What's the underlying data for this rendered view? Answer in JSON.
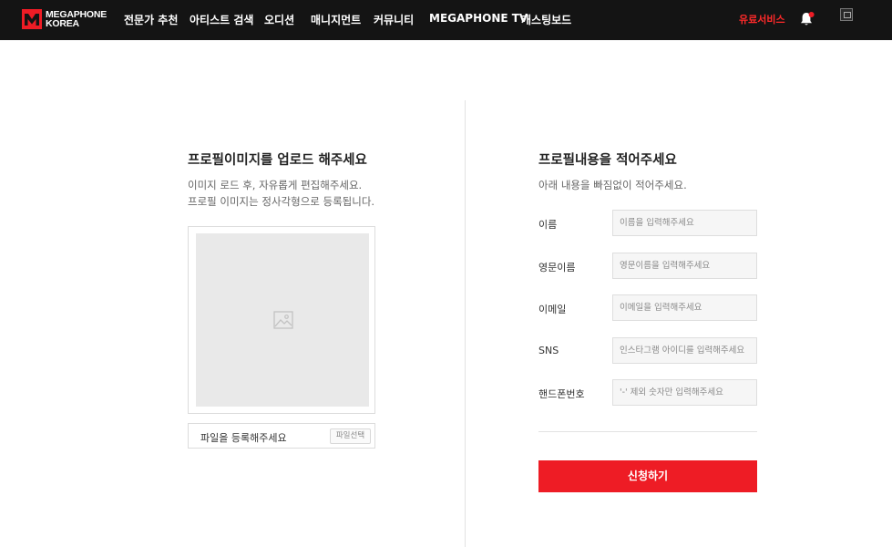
{
  "header": {
    "logo": {
      "line1": "MEGAPHONE",
      "line2": "KOREA"
    },
    "nav": [
      {
        "label": "전문가 추천"
      },
      {
        "label": "아티스트 검색"
      },
      {
        "label": "오디션"
      },
      {
        "label": "매니지먼트"
      },
      {
        "label": "커뮤니티"
      },
      {
        "label": "MEGAPHONE TV"
      },
      {
        "label": "캐스팅보드"
      }
    ],
    "paid_service": "유료서비스",
    "icons": {
      "bell": "bell-icon",
      "avatar": "broken-image-icon"
    },
    "colors": {
      "background": "#141414",
      "accent": "#ee1c25",
      "paid_text": "#ff2a2a"
    }
  },
  "upload": {
    "title": "프로필이미지를 업로드 해주세요",
    "desc_line1": "이미지 로드 후, 자유롭게 편집해주세요.",
    "desc_line2": "프로필 이미지는 정사각형으로 등록됩니다.",
    "preview_icon": "image-placeholder-icon",
    "file_placeholder": "파일을 등록해주세요",
    "file_button": "파일선택"
  },
  "form": {
    "title": "프로필내용을 적어주세요",
    "desc": "아래 내용을 빠짐없이 적어주세요.",
    "fields": [
      {
        "label": "이름",
        "placeholder": "이름을 입력해주세요",
        "value": ""
      },
      {
        "label": "영문이름",
        "placeholder": "영문이름을 입력해주세요",
        "value": ""
      },
      {
        "label": "이메일",
        "placeholder": "이메일을 입력해주세요",
        "value": ""
      },
      {
        "label": "SNS",
        "placeholder": "인스타그램 아이디를 입력해주세요",
        "value": ""
      },
      {
        "label": "핸드폰번호",
        "placeholder": "'-' 제외 숫자만 입력해주세요",
        "value": ""
      }
    ],
    "submit": "신청하기",
    "submit_color": "#ee1c25"
  }
}
